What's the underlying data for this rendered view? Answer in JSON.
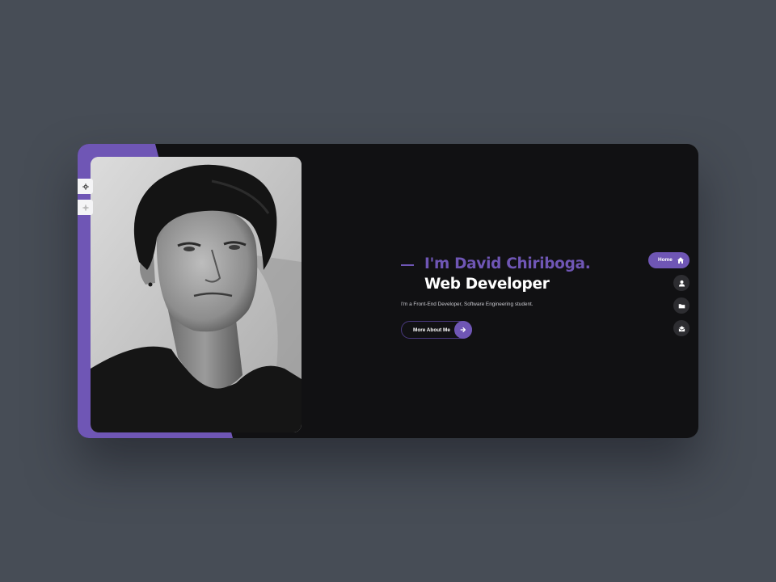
{
  "colors": {
    "background": "#474d56",
    "card": "#111113",
    "accent": "#6f56b5",
    "text_primary": "#ffffff",
    "text_secondary": "#c9c9cf"
  },
  "side_tools": [
    {
      "icon": "gear-icon"
    },
    {
      "icon": "sparkle-icon"
    }
  ],
  "profile_photo": {
    "style": "black-and-white portrait"
  },
  "hero": {
    "name": "I'm David Chiriboga.",
    "role": "Web Developer",
    "description": "I'm a Front-End Developer, Software Engineering student.",
    "button_label": "More About Me",
    "button_icon": "arrow-right-icon"
  },
  "nav": {
    "home_label": "Home",
    "home_icon": "house-icon",
    "items": [
      {
        "icon": "user-icon"
      },
      {
        "icon": "folder-icon"
      },
      {
        "icon": "envelope-open-icon"
      }
    ]
  }
}
